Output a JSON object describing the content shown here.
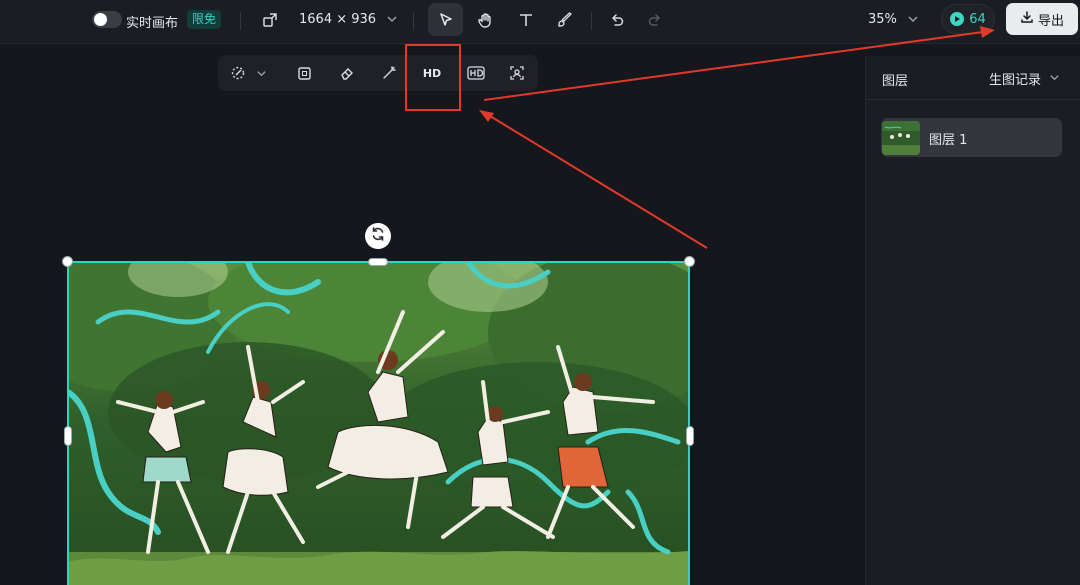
{
  "topbar": {
    "realtime_label": "实时画布",
    "realtime_badge": "限免",
    "canvas_size": "1664 × 936",
    "zoom": "35%",
    "credits": "64",
    "export_label": "导出"
  },
  "subtoolbar": {
    "hd_label": "HD"
  },
  "panel": {
    "title": "图层",
    "history_label": "生图记录",
    "layers": [
      {
        "name": "图层 1"
      }
    ]
  },
  "colors": {
    "accent": "#34d0c0",
    "annotation": "#e03a2c",
    "background": "#15171c",
    "panel": "#1b1d22"
  },
  "icons": {
    "resize": "resize-icon",
    "select": "cursor-icon",
    "hand": "hand-icon",
    "text": "text-icon",
    "brush": "brush-icon",
    "undo": "undo-icon",
    "redo": "redo-icon"
  }
}
